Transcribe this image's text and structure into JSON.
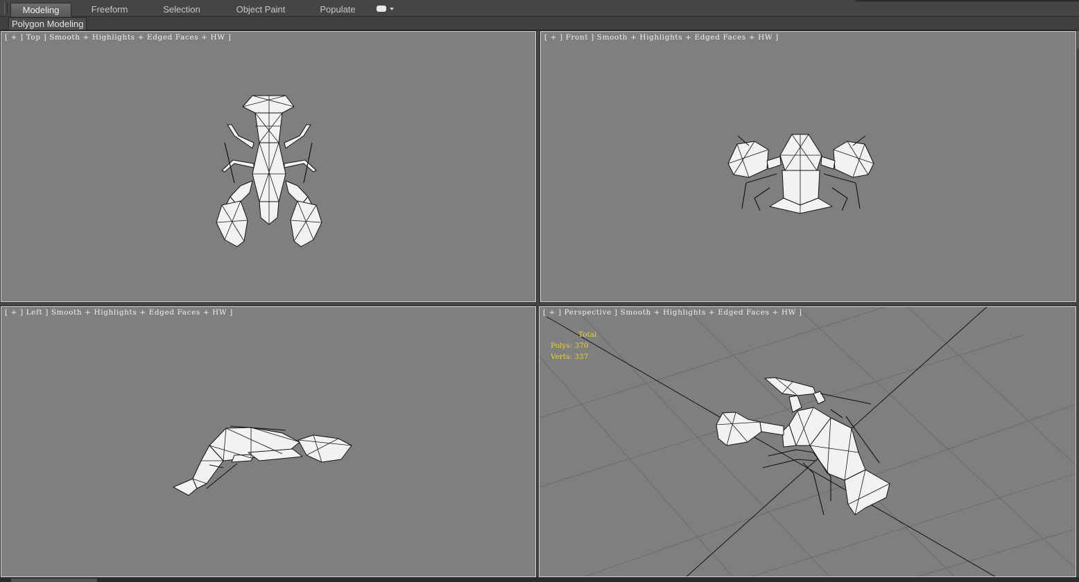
{
  "ribbon": {
    "tabs": [
      {
        "label": "Modeling",
        "active": true
      },
      {
        "label": "Freeform",
        "active": false
      },
      {
        "label": "Selection",
        "active": false
      },
      {
        "label": "Object Paint",
        "active": false
      },
      {
        "label": "Populate",
        "active": false
      }
    ],
    "panel_title": "Polygon Modeling"
  },
  "viewports": {
    "top": {
      "label": "[ + ] Top ] Smooth + Highlights + Edged Faces + HW ]"
    },
    "front": {
      "label": "[ + ] Front ] Smooth + Highlights + Edged Faces + HW ]"
    },
    "left": {
      "label": "[ + ] Left ] Smooth + Highlights + Edged Faces + HW ]"
    },
    "perspective": {
      "label": "[ + ] Perspective ] Smooth + Highlights + Edged Faces + HW ]"
    }
  },
  "stats": {
    "title": "Total",
    "polys": "Polys: 370",
    "verts": "Verts: 337"
  },
  "colors": {
    "viewport_bg": "#7f7f7f",
    "stats_text": "#e9d22e",
    "ui_bg": "#444444"
  }
}
